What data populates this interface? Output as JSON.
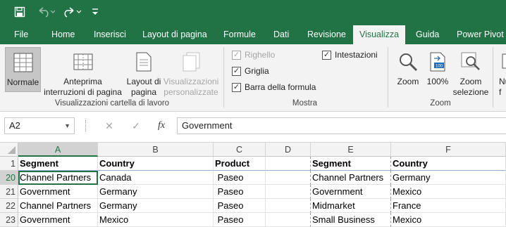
{
  "quick_access": {
    "icons": [
      "save-icon",
      "undo-icon",
      "redo-icon",
      "customize-icon"
    ]
  },
  "tabs": [
    {
      "label": "File"
    },
    {
      "label": "Home"
    },
    {
      "label": "Inserisci"
    },
    {
      "label": "Layout di pagina"
    },
    {
      "label": "Formule"
    },
    {
      "label": "Dati"
    },
    {
      "label": "Revisione"
    },
    {
      "label": "Visualizza",
      "active": true
    },
    {
      "label": "Guida"
    },
    {
      "label": "Power Pivot"
    }
  ],
  "ribbon": {
    "group1": {
      "label": "Visualizzazioni cartella di lavoro",
      "normale": "Normale",
      "anteprima": "Anteprima interruzioni di pagina",
      "layout": "Layout di pagina",
      "personalizzate": "Visualizzazioni personalizzate"
    },
    "group2": {
      "label": "Mostra",
      "righello": {
        "label": "Righello",
        "checked": true,
        "disabled": true
      },
      "griglia": {
        "label": "Griglia",
        "checked": true
      },
      "barra_formula": {
        "label": "Barra della formula",
        "checked": true
      },
      "intestazioni": {
        "label": "Intestazioni",
        "checked": true
      }
    },
    "group3": {
      "label": "Zoom",
      "zoom": "Zoom",
      "cento": "100%",
      "zoom_selezione": "Zoom selezione"
    },
    "overflow": "Nuova f"
  },
  "formula_bar": {
    "name_box": "A2",
    "content": "Government",
    "cancel": "✕",
    "enter": "✓",
    "fx": "fx"
  },
  "sheet": {
    "columns": [
      "A",
      "B",
      "C",
      "D",
      "E",
      "F"
    ],
    "selected_column": "A",
    "rows": [
      {
        "num": "1",
        "cells": [
          "Segment",
          "Country",
          "Product",
          "",
          "Segment",
          "Country"
        ]
      },
      {
        "num": "20",
        "cells": [
          "Channel Partners",
          "Canada",
          " Paseo",
          "",
          "Channel Partners",
          "Germany"
        ]
      },
      {
        "num": "21",
        "cells": [
          "Government",
          "Germany",
          " Paseo",
          "",
          "Government",
          "Mexico"
        ]
      },
      {
        "num": "22",
        "cells": [
          "Channel Partners",
          "Germany",
          " Paseo",
          "",
          "Midmarket",
          "France"
        ]
      },
      {
        "num": "23",
        "cells": [
          "Government",
          "Mexico",
          " Paseo",
          "",
          "Small Business",
          "Mexico"
        ]
      }
    ]
  },
  "colors": {
    "accent": "#217346",
    "ribbon_bg": "#f3f3f3"
  }
}
